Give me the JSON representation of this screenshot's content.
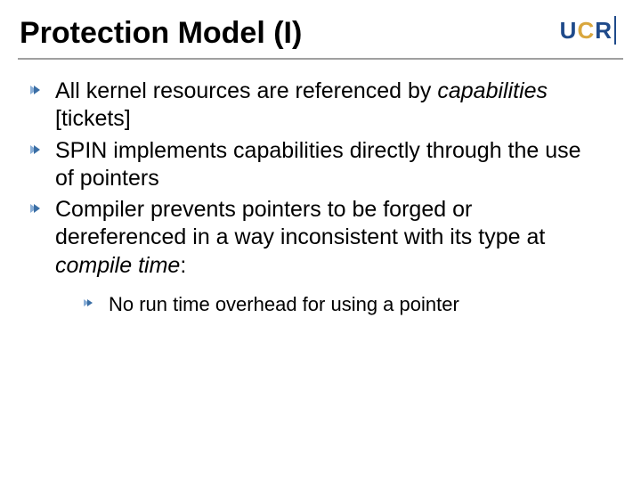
{
  "title": "Protection Model (I)",
  "logo": {
    "u": "U",
    "c": "C",
    "r": "R"
  },
  "bullets": {
    "b1_pre": "All kernel resources are referenced by ",
    "b1_em": "capabilities",
    "b1_post": " [tickets]",
    "b2": "SPIN implements capabilities directly through the use of pointers",
    "b3_pre": "Compiler prevents pointers to be forged or dereferenced in a way inconsistent with its type at ",
    "b3_em": "compile time",
    "b3_post": ":",
    "sub1": "No run time overhead for using a pointer"
  }
}
